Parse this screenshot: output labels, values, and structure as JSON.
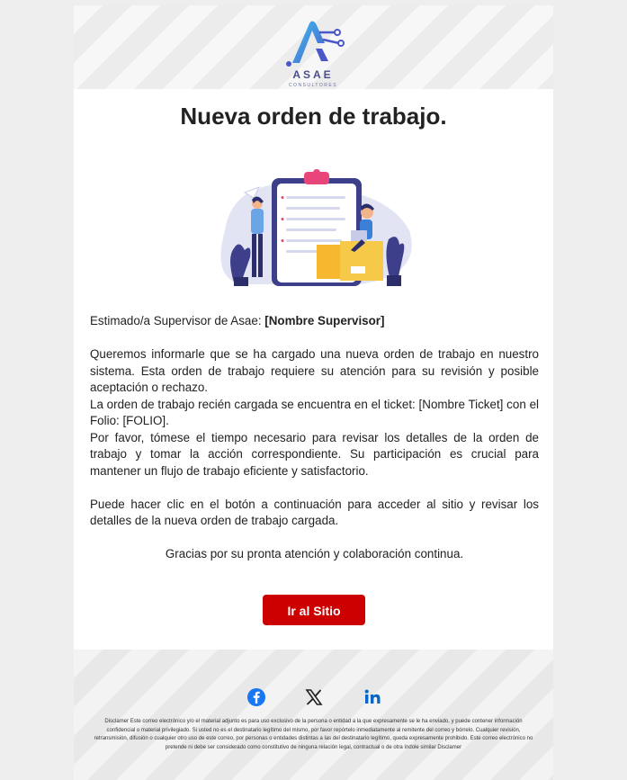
{
  "logo": {
    "name": "ASAE",
    "subtitle": "CONSULTORES"
  },
  "email": {
    "title": "Nueva orden de trabajo.",
    "greeting_prefix": "Estimado/a Supervisor de Asae: ",
    "greeting_name": "[Nombre Supervisor]",
    "para1": "Queremos informarle que se ha cargado una nueva orden de trabajo en nuestro sistema. Esta orden de trabajo requiere su atención para su revisión y posible aceptación o rechazo.",
    "para2": "La orden de trabajo recién cargada se encuentra en el ticket: [Nombre Ticket] con el Folio: [FOLIO].",
    "para3": "Por favor, tómese el tiempo necesario para revisar los detalles de la orden de trabajo y tomar la acción correspondiente. Su participación es crucial para mantener un flujo de trabajo eficiente y satisfactorio.",
    "para4": "Puede hacer clic en el botón a continuación para acceder al sitio y revisar los detalles de la nueva orden de trabajo cargada.",
    "thanks": "Gracias por su pronta atención y colaboración continua.",
    "button_label": "Ir al Sitio"
  },
  "footer": {
    "social": [
      "facebook-icon",
      "x-icon",
      "linkedin-icon"
    ],
    "disclaimer": "Disclamer Este correo electrónico y/o el material adjunto es para uso exclusivo de la persona o entidad a la que expresamente se le ha enviado, y puede contener información confidencial o material privilegiado. Si usted no es el destinatario legítimo del mismo, por favor repórtelo inmediatamente al remitente del correo y bórrelo. Cualquier revisión, retransmisión, difusión o cualquier otro uso de este correo, por personas o entidades distintas a las del destinatario legítimo, queda expresamente prohibido. Este correo electrónico no pretende ni debe ser considerado como constitutivo de ninguna relación legal, contractual o de otra índole similar Disclamer"
  },
  "colors": {
    "accent": "#cc0000",
    "logo": "#4a4f8c",
    "facebook": "#1877f2",
    "linkedin": "#0a66c2"
  }
}
